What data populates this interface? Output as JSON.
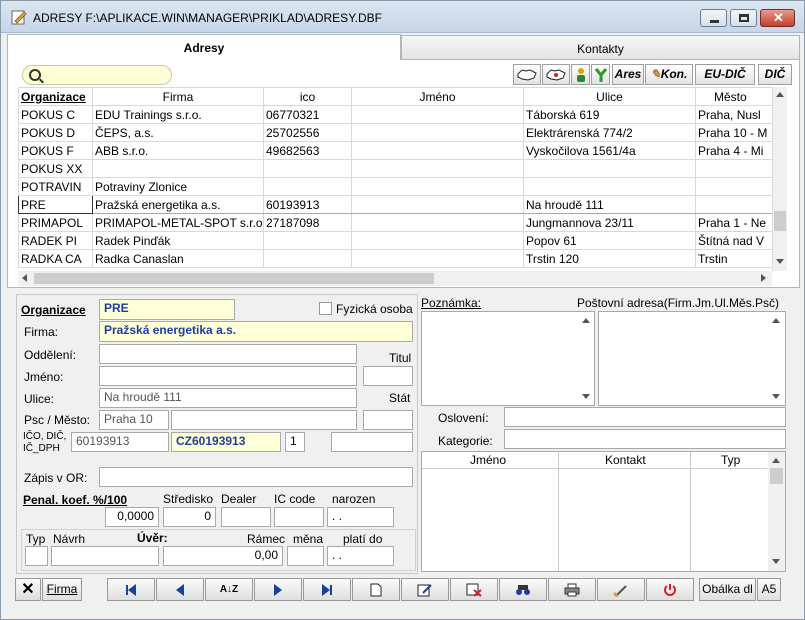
{
  "window": {
    "title": "ADRESY F:\\APLIKACE.WIN\\MANAGER\\PRIKLAD\\ADRESY.DBF"
  },
  "tabs": [
    {
      "label": "Adresy"
    },
    {
      "label": "Kontakty"
    }
  ],
  "toolbar": {
    "ares": "Ares",
    "kon": "Kon.",
    "eudic": "EU-DIČ",
    "dic": "DIČ"
  },
  "grid": {
    "columns": [
      "Organizace",
      "Firma",
      "ico",
      "Jméno",
      "Ulice",
      "Město"
    ],
    "rows": [
      [
        "POKUS C",
        "EDU Trainings s.r.o.",
        "06770321",
        "",
        "Táborská 619",
        "Praha, Nusl"
      ],
      [
        "POKUS D",
        "ČEPS, a.s.",
        "25702556",
        "",
        "Elektrárenská 774/2",
        "Praha 10 - M"
      ],
      [
        "POKUS F",
        "ABB s.r.o.",
        "49682563",
        "",
        "Vyskočilova 1561/4a",
        "Praha 4 - Mi"
      ],
      [
        "POKUS XX",
        "",
        "",
        "",
        "",
        ""
      ],
      [
        "POTRAVIN",
        "Potraviny Zlonice",
        "",
        "",
        "",
        ""
      ],
      [
        "PRE",
        "Pražská energetika a.s.",
        "60193913",
        "",
        "Na hroudě 111",
        ""
      ],
      [
        "PRIMAPOL",
        "PRIMAPOL-METAL-SPOT s.r.o.",
        "27187098",
        "",
        "Jungmannova 23/11",
        "Praha 1 - Ne"
      ],
      [
        "RADEK PI",
        "Radek Pinďák",
        "",
        "",
        "Popov 61",
        "Štítná nad V"
      ],
      [
        "RADKA CA",
        "Radka Canaslan",
        "",
        "",
        "Trstin 120",
        "Trstin"
      ]
    ]
  },
  "form": {
    "organizace_label": "Organizace",
    "organizace": "PRE",
    "fyzicka_label": "Fyzická osoba",
    "firma_label": "Firma:",
    "firma": "Pražská energetika a.s.",
    "oddeleni_label": "Oddělení:",
    "oddeleni": "",
    "titul_label": "Titul",
    "jmeno_label": "Jméno:",
    "jmeno": "",
    "ulice_label": "Ulice:",
    "ulice": "Na hroudě 111",
    "stat_label": "Stát",
    "psc_label": "Psc / Město:",
    "psc": "Praha 10",
    "mesto": "",
    "ico_label_1": "IČO, DIČ,",
    "ico_label_2": "IČ_DPH",
    "ico": "60193913",
    "dic": "CZ60193913",
    "dph_flag": "1",
    "ic_dph": "",
    "zapis_label": "Zápis v OR:",
    "zapis": "",
    "penal_label": "Penal. koef. %/100",
    "penal": "0,0000",
    "stredisko_label": "Středisko",
    "stredisko": "0",
    "dealer_label": "Dealer",
    "ic_code_label": "IC code",
    "narozen_label": "narozen",
    "narozen": ". .",
    "typ_label": "Typ",
    "navrh_label": "Návrh",
    "uver_label": "Úvěr:",
    "ramec_label": "Rámec",
    "ramec": "0,00",
    "mena_label": "měna",
    "plati_label": "platí do",
    "plati": ". ."
  },
  "right": {
    "poznamka_label": "Poznámka:",
    "postovni_label": "Poštovní adresa(Firm.Jm.Ul.Měs.Psč)",
    "osloveni_label": "Oslovení:",
    "kategorie_label": "Kategorie:",
    "contacts_columns": [
      "Jméno",
      "Kontakt",
      "Typ"
    ]
  },
  "bottom": {
    "firma": "Firma",
    "obalka": "Obálka dl",
    "a5": "A5"
  },
  "colors": {
    "selected_border": "#7fb2e0",
    "input_highlight": "#ffffd8",
    "value_blue": "#1f3ea0"
  }
}
